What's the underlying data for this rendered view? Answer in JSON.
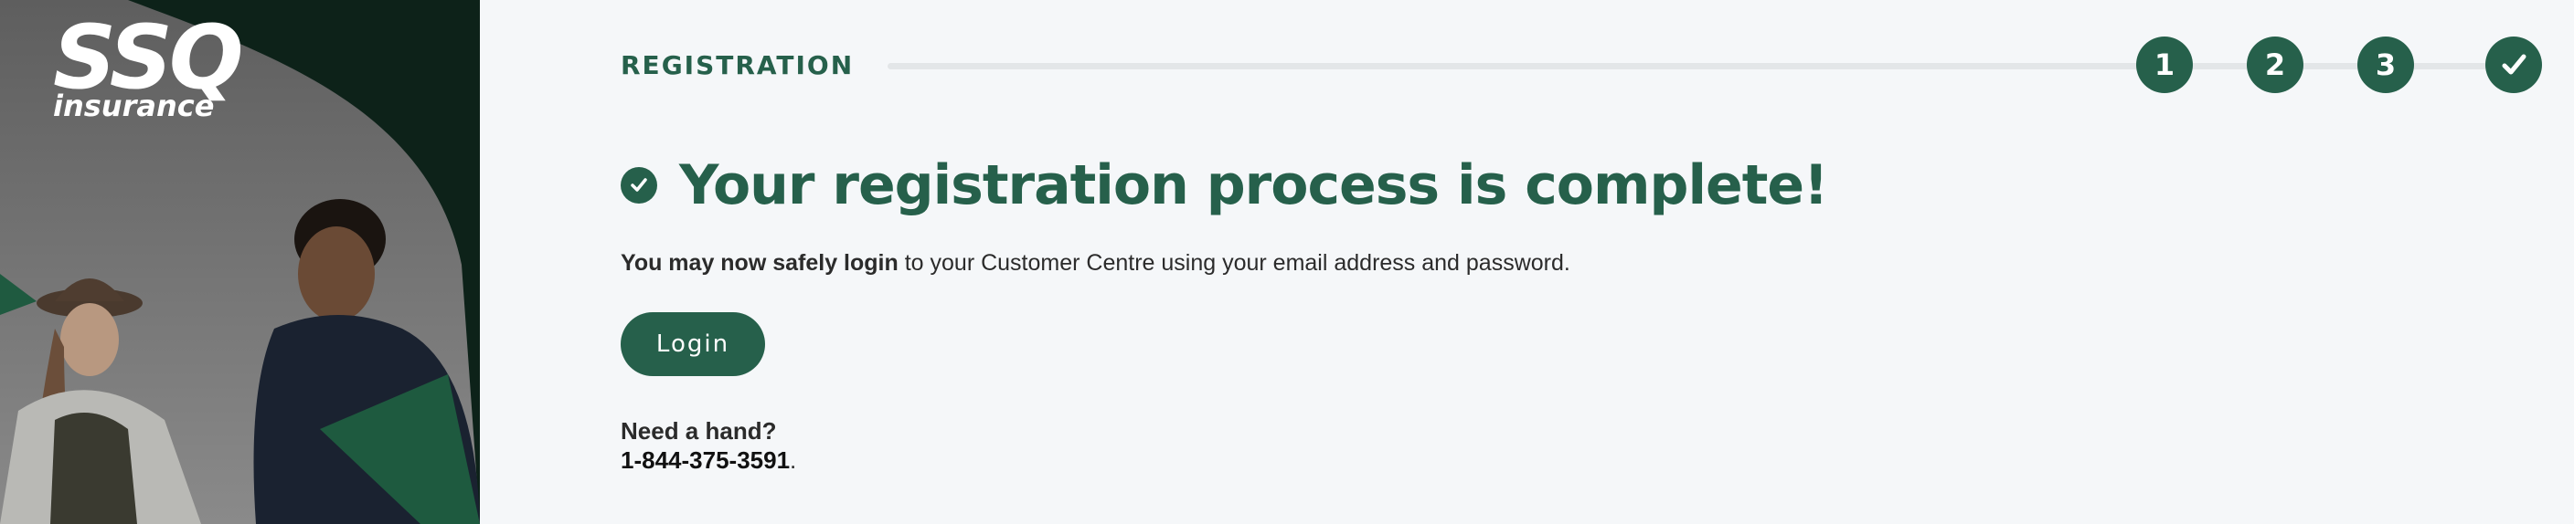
{
  "brand": {
    "logo_mark": "SSQ",
    "logo_sub": "insurance",
    "accent_color": "#26604b",
    "dark_panel_color": "#0d2219"
  },
  "stepper": {
    "title": "REGISTRATION",
    "steps": [
      {
        "label": "1"
      },
      {
        "label": "2"
      },
      {
        "label": "3"
      },
      {
        "label": "✓",
        "icon": "checkmark-icon"
      }
    ]
  },
  "confirmation": {
    "icon": "check-circle-icon",
    "headline": "Your registration process is complete!",
    "message_strong": "You may now safely login",
    "message_rest": " to your Customer Centre using your email address and password."
  },
  "login_button": {
    "label": "Login"
  },
  "help": {
    "heading": "Need a hand?",
    "phone": "1-844-375-3591",
    "phone_suffix": "."
  }
}
